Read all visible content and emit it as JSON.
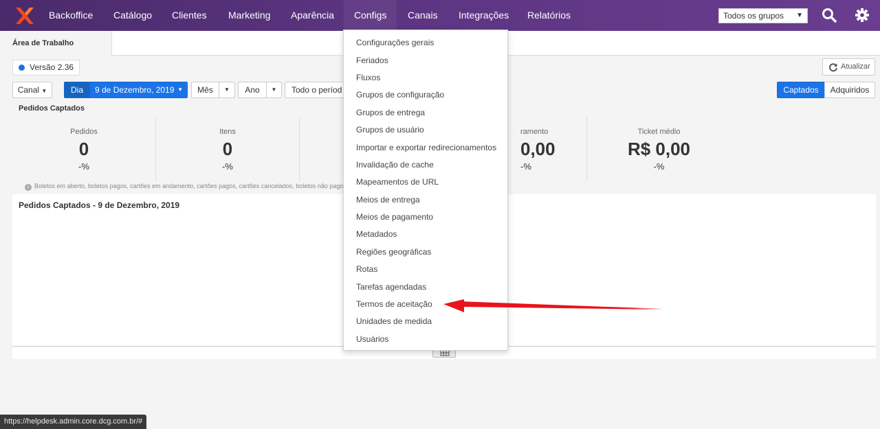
{
  "nav": {
    "items": [
      "Backoffice",
      "Catálogo",
      "Clientes",
      "Marketing",
      "Aparência",
      "Configs",
      "Canais",
      "Integrações",
      "Relatórios"
    ],
    "group_select": "Todos os grupos",
    "brand_color": "#5b3480"
  },
  "tabs": {
    "active": "Área de Trabalho"
  },
  "version": "Versão 2.36",
  "refresh_label": "Atualizar",
  "filters": {
    "canal": "Canal",
    "dia": "Dia",
    "date": "9 de Dezembro, 2019",
    "mes": "Mês",
    "ano": "Ano",
    "todo_periodo": "Todo o períod",
    "captados": "Captados",
    "adquiridos": "Adquiridos"
  },
  "section_title": "Pedidos Captados",
  "stats": [
    {
      "label": "Pedidos",
      "value": "0",
      "pct": "-%"
    },
    {
      "label": "Itens",
      "value": "0",
      "pct": "-%"
    },
    {
      "label": "ramento",
      "value": "0,00",
      "pct": "-%"
    },
    {
      "label": "Ticket médio",
      "value": "R$ 0,00",
      "pct": "-%"
    }
  ],
  "note": "Boletos em aberto, boletos pagos, cartões em andamento, cartões pagos, cartões cancelados, boletos não pagos, pedido",
  "panel_title": "Pedidos Captados - 9 de Dezembro, 2019",
  "configs_menu": [
    "Configurações gerais",
    "Feriados",
    "Fluxos",
    "Grupos de configuração",
    "Grupos de entrega",
    "Grupos de usuário",
    "Importar e exportar redirecionamentos",
    "Invalidação de cache",
    "Mapeamentos de URL",
    "Meios de entrega",
    "Meios de pagamento",
    "Metadados",
    "Regiões geográficas",
    "Rotas",
    "Tarefas agendadas",
    "Termos de aceitação",
    "Unidades de medida",
    "Usuários"
  ],
  "status_url": "https://helpdesk.admin.core.dcg.com.br/#",
  "colors": {
    "accent": "#1a73e8",
    "annotation_arrow": "#e8141c"
  }
}
